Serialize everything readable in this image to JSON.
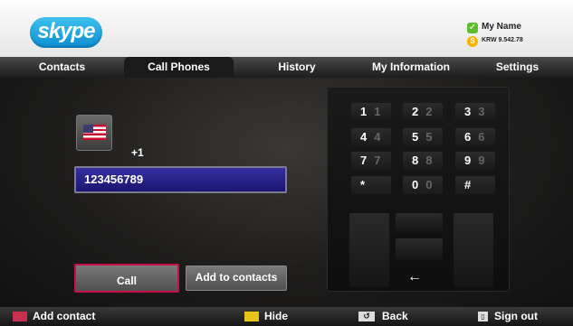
{
  "header": {
    "logo": "skype",
    "user_name": "My Name",
    "user_credit": "KRW 9.542.78",
    "status_icon": "online-check-icon",
    "credit_icon": "skype-credit-icon"
  },
  "tabs": [
    {
      "label": "Contacts"
    },
    {
      "label": "Call Phones",
      "active": true
    },
    {
      "label": "History"
    },
    {
      "label": "My Information"
    },
    {
      "label": "Settings"
    }
  ],
  "dialer": {
    "country_flag": "us-flag-icon",
    "country_code": "+1",
    "number": "123456789",
    "call_label": "Call",
    "add_label": "Add to contacts"
  },
  "keypad": {
    "keys": [
      {
        "main": "1",
        "sub": "1"
      },
      {
        "main": "2",
        "sub": "2"
      },
      {
        "main": "3",
        "sub": "3"
      },
      {
        "main": "4",
        "sub": "4"
      },
      {
        "main": "5",
        "sub": "5"
      },
      {
        "main": "6",
        "sub": "6"
      },
      {
        "main": "7",
        "sub": "7"
      },
      {
        "main": "8",
        "sub": "8"
      },
      {
        "main": "9",
        "sub": "9"
      },
      {
        "main": "*",
        "sub": ""
      },
      {
        "main": "0",
        "sub": "0"
      },
      {
        "main": "#",
        "sub": ""
      }
    ],
    "backspace": "←"
  },
  "bottom": {
    "add_contact": "Add contact",
    "hide": "Hide",
    "back": "Back",
    "sign_out": "Sign out",
    "colors": {
      "red": "#c8304f",
      "yellow": "#e9c51a"
    }
  }
}
